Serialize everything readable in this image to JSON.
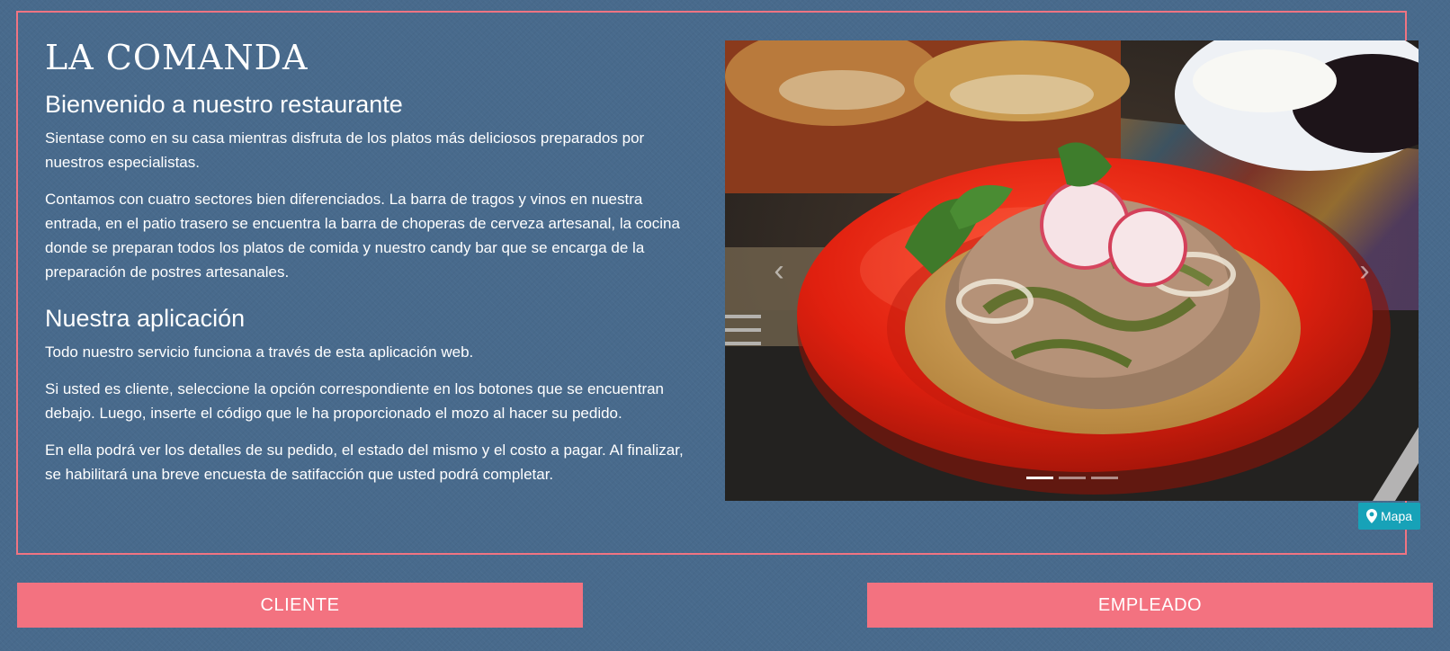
{
  "brand": "LA COMANDA",
  "intro": {
    "heading": "Bienvenido a nuestro restaurante",
    "paragraphs": [
      "Sientase como en su casa mientras disfruta de los platos más deliciosos preparados por nuestros especialistas.",
      "Contamos con cuatro sectores bien diferenciados. La barra de tragos y vinos en nuestra entrada, en el patio trasero se encuentra la barra de choperas de cerveza artesanal, la cocina donde se preparan todos los platos de comida y nuestro candy bar que se encarga de la preparación de postres artesanales."
    ]
  },
  "app": {
    "heading": "Nuestra aplicación",
    "paragraphs": [
      "Todo nuestro servicio funciona a través de esta aplicación web.",
      "Si usted es cliente, seleccione la opción correspondiente en los botones que se encuentran debajo. Luego, inserte el código que le ha proporcionado el mozo al hacer su pedido.",
      "En ella podrá ver los detalles de su pedido, el estado del mismo y el costo a pagar. Al finalizar, se habilitará una breve encuesta de satifacción que usted podrá completar."
    ]
  },
  "carousel": {
    "prev_icon": "‹",
    "next_icon": "›",
    "slide_count": 3,
    "active_slide": 1
  },
  "map_button": {
    "label": "Mapa",
    "icon": "map-marker-icon"
  },
  "buttons": {
    "cliente": "CLIENTE",
    "empleado": "EMPLEADO"
  },
  "colors": {
    "background": "#486a8c",
    "accent": "#f37280",
    "map_button": "#17a2b8"
  }
}
